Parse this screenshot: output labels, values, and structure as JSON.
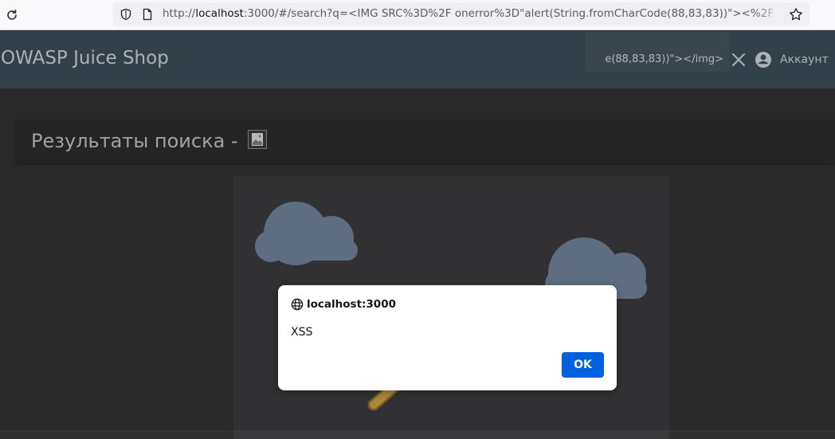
{
  "browser": {
    "url_prefix": "http://",
    "url_host": "localhost",
    "url_rest": ":3000/#/search?q=<IMG SRC%3D%2F onerror%3D\"alert(String.fromCharCode(88,83,83))\"><%2F",
    "icons": {
      "reload": "reload-icon",
      "shield": "shield-icon",
      "page": "page-icon",
      "bookmark": "star-icon"
    }
  },
  "toolbar": {
    "title": "OWASP Juice Shop",
    "search_value": "e(88,83,83))\"></img>",
    "account_label": "Аккаунт",
    "icons": {
      "clear": "close-icon",
      "account": "account-circle-icon"
    }
  },
  "results": {
    "title": "Результаты поиска -"
  },
  "alert": {
    "origin": "localhost:3000",
    "message": "XSS",
    "ok_label": "OK"
  },
  "colors": {
    "toolbar_bg": "#3b4c55",
    "page_bg": "#303030",
    "ok_button": "#0061e0"
  }
}
